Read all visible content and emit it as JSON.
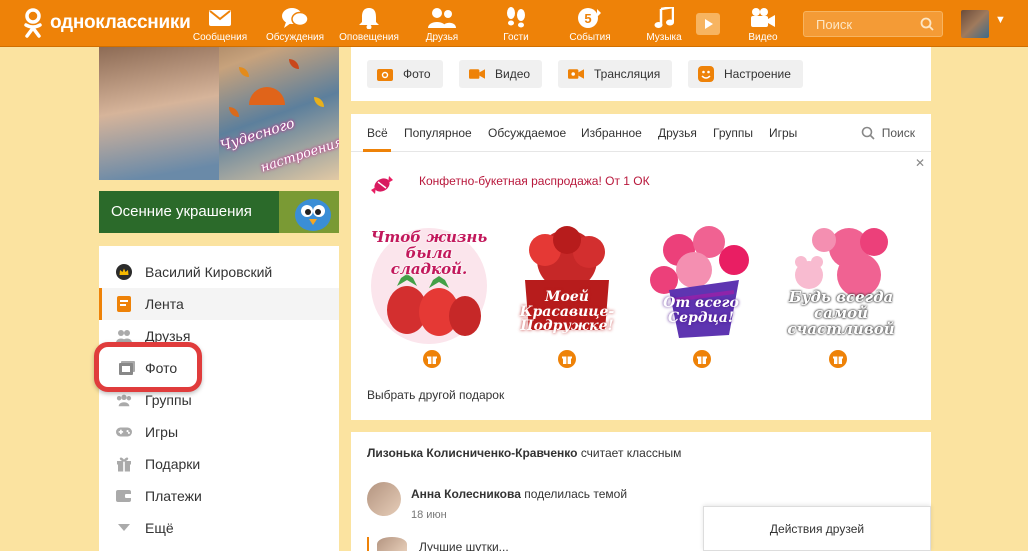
{
  "header": {
    "logo_text": "одноклассники",
    "nav": [
      {
        "id": "messages",
        "label": "Сообщения",
        "icon": "envelope-icon"
      },
      {
        "id": "discussions",
        "label": "Обсуждения",
        "icon": "chat-bubbles-icon"
      },
      {
        "id": "alerts",
        "label": "Оповещения",
        "icon": "bell-icon"
      },
      {
        "id": "friends",
        "label": "Друзья",
        "icon": "people-icon"
      },
      {
        "id": "guests",
        "label": "Гости",
        "icon": "footprints-icon"
      },
      {
        "id": "events",
        "label": "События",
        "icon": "events-icon",
        "badge": "5"
      },
      {
        "id": "music",
        "label": "Музыка",
        "icon": "music-note-icon"
      },
      {
        "id": "video",
        "label": "Видео",
        "icon": "video-camera-icon"
      }
    ],
    "search_placeholder": "Поиск"
  },
  "left": {
    "promo_image_text_1": "Чудесного",
    "promo_image_text_2": "настроения!",
    "banner_text": "Осенние украшения",
    "menu": [
      {
        "label": "Василий Кировский",
        "icon": "crown-icon"
      },
      {
        "label": "Лента",
        "icon": "feed-icon",
        "active": true
      },
      {
        "label": "Друзья",
        "icon": "friends-icon"
      },
      {
        "label": "Фото",
        "icon": "photo-icon"
      },
      {
        "label": "Группы",
        "icon": "groups-icon"
      },
      {
        "label": "Игры",
        "icon": "gamepad-icon"
      },
      {
        "label": "Подарки",
        "icon": "gift-icon"
      },
      {
        "label": "Платежи",
        "icon": "wallet-icon"
      },
      {
        "label": "Ещё",
        "icon": "chevron-down-icon"
      }
    ]
  },
  "post_bar": {
    "buttons": [
      {
        "label": "Фото",
        "icon": "camera-icon"
      },
      {
        "label": "Видео",
        "icon": "video-camera-icon"
      },
      {
        "label": "Трансляция",
        "icon": "broadcast-icon"
      },
      {
        "label": "Настроение",
        "icon": "smile-icon"
      }
    ]
  },
  "feed": {
    "tabs": [
      "Всё",
      "Популярное",
      "Обсуждаемое",
      "Избранное",
      "Друзья",
      "Группы",
      "Игры"
    ],
    "search_label": "Поиск",
    "promo_text": "Конфетно-букетная распродажа! От 1 ОК",
    "gifts": [
      {
        "text": "Чтоб жизнь была сладкой."
      },
      {
        "text": "Моей Красавице-Подружке!"
      },
      {
        "text": "От всего Сердца!"
      },
      {
        "text": "Будь всегда самой счастливой"
      }
    ],
    "choose_other": "Выбрать другой подарок"
  },
  "post": {
    "header_name": "Лизонька Колисниченко-Кравченко",
    "header_action": "считает классным",
    "author": "Анна Колесникова",
    "author_action": "поделилась темой",
    "date": "18 июн",
    "next_preview": "Лучшие шутки..."
  },
  "friends_actions_label": "Действия друзей",
  "colors": {
    "brand_orange": "#ee8208",
    "highlight_red": "#e03c3c",
    "promo_red": "#b8173b",
    "page_bg": "#fbe3a0"
  }
}
